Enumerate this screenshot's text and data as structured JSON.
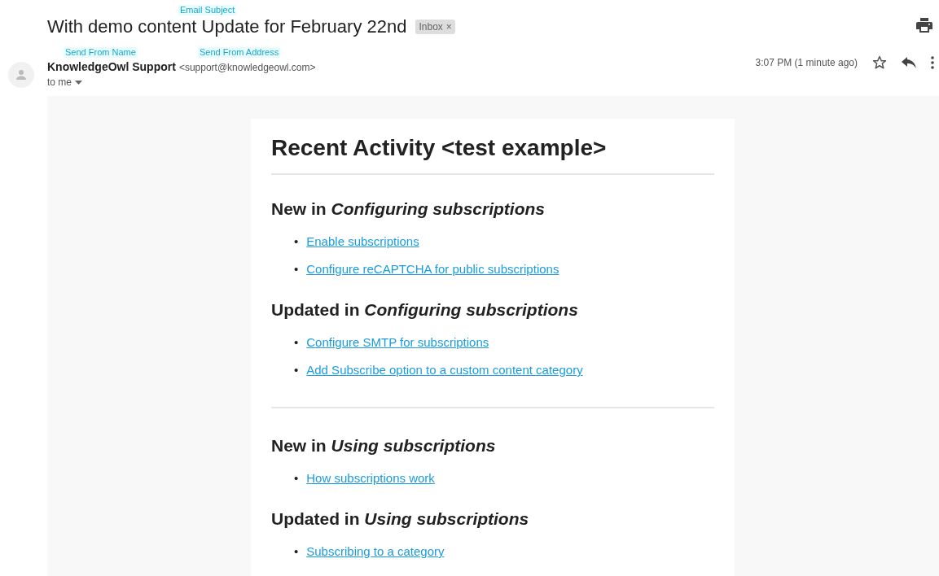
{
  "annotations": {
    "subject": "Email Subject",
    "from_name": "Send From Name",
    "from_address": "Send From Address"
  },
  "subject": "With demo content Update for February 22nd",
  "label_chip": {
    "label": "Inbox",
    "close": "×"
  },
  "sender": {
    "name": "KnowledgeOwl Support",
    "address": "<support@knowledgeowl.com>",
    "recipient": "to me",
    "time": "3:07 PM (1 minute ago)",
    "starred": false
  },
  "email": {
    "title": "Recent Activity <test example>",
    "bullet": "•",
    "groups": [
      {
        "sections": [
          {
            "prefix": "New in",
            "category": "Configuring subscriptions",
            "links": [
              "Enable subscriptions",
              "Configure reCAPTCHA for public subscriptions"
            ]
          },
          {
            "prefix": "Updated in",
            "category": "Configuring subscriptions",
            "links": [
              "Configure SMTP for subscriptions",
              "Add Subscribe option to a custom content category"
            ]
          }
        ]
      },
      {
        "sections": [
          {
            "prefix": "New in",
            "category": "Using subscriptions",
            "links": [
              "How subscriptions work"
            ]
          },
          {
            "prefix": "Updated in",
            "category": "Using subscriptions",
            "links": [
              "Subscribing to a category"
            ]
          }
        ]
      }
    ]
  }
}
